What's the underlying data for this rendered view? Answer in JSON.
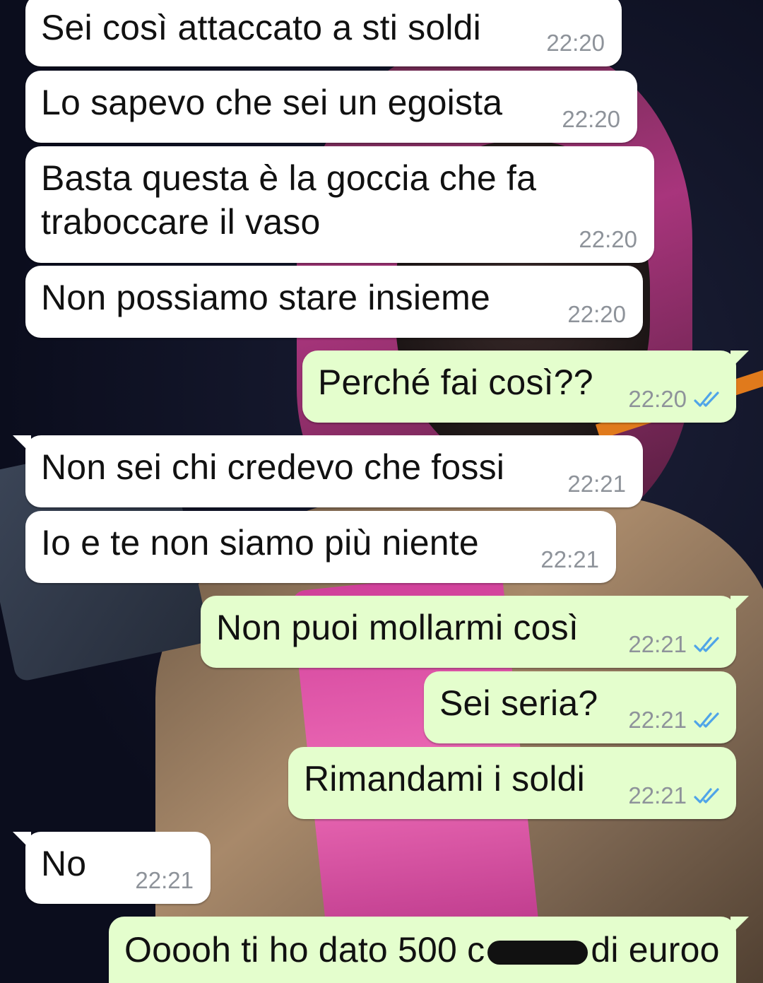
{
  "chat": {
    "messages": [
      {
        "text": "Sei così attaccato a sti soldi",
        "time": "22:20"
      },
      {
        "text": "Lo sapevo che sei un egoista",
        "time": "22:20"
      },
      {
        "text": "Basta questa è la goccia che fa traboccare il vaso",
        "time": "22:20"
      },
      {
        "text": "Non possiamo stare insieme",
        "time": "22:20"
      },
      {
        "text": "Perché fai così??",
        "time": "22:20"
      },
      {
        "text": "Non sei chi credevo che fossi",
        "time": "22:21"
      },
      {
        "text": "Io e te non siamo più niente",
        "time": "22:21"
      },
      {
        "text": "Non puoi mollarmi così",
        "time": "22:21"
      },
      {
        "text": "Sei seria?",
        "time": "22:21"
      },
      {
        "text": "Rimandami i soldi",
        "time": "22:21"
      },
      {
        "text": "No",
        "time": "22:21"
      },
      {
        "text_before": "Ooooh ti ho dato 500 c",
        "text_after": "di euroo"
      }
    ]
  },
  "colors": {
    "incoming_bubble": "#ffffff",
    "outgoing_bubble": "#e4fecd",
    "read_ticks": "#4fa4e8",
    "timestamp": "#8e939a"
  },
  "icons": {
    "read_receipt": "double-check-icon"
  }
}
